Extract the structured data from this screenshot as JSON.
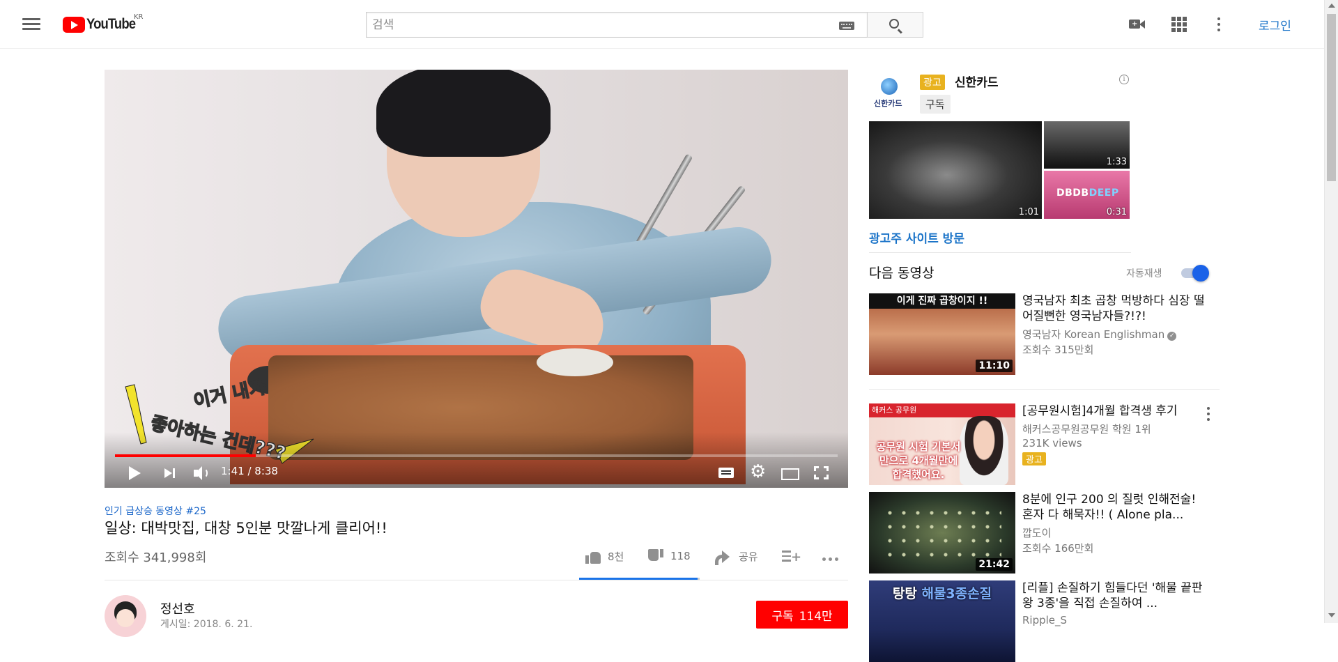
{
  "header": {
    "logo_text": "YouTube",
    "country_code": "KR",
    "search_placeholder": "검색",
    "search_value": "",
    "login_label": "로그인"
  },
  "player": {
    "caption_line1": "이거 내가",
    "caption_line2": "좋아하는 건데???",
    "time_current": "1:41",
    "time_separator": " / ",
    "time_total": "8:38",
    "progress_fraction": 0.195,
    "volume": "on"
  },
  "video": {
    "trending_label": "인기 급상승 동영상 #25",
    "title": "일상: 대박맛집, 대창 5인분 맛깔나게 클리어!!",
    "views": "조회수 341,998회",
    "likes": "8천",
    "dislikes": "118",
    "share_label": "공유",
    "like_ratio": 0.985
  },
  "channel": {
    "name": "정선호",
    "publish_date": "게시일: 2018. 6. 21.",
    "subscribe_label": "구독",
    "subscriber_count": "114만"
  },
  "ad": {
    "logo_text": "신한카드",
    "badge": "광고",
    "name": "신한카드",
    "subscribe_label": "구독",
    "thumb_durations": [
      "1:01",
      "1:33",
      "0:31"
    ],
    "thumb3_text_a": "DBDB",
    "thumb3_text_b": "DEEP",
    "visit_label": "광고주 사이트 방문"
  },
  "sidebar": {
    "up_next_label": "다음 동영상",
    "autoplay_label": "자동재생",
    "autoplay_on": true,
    "recommendations": [
      {
        "thumb_text": "이게 진짜 곱창이지 !!",
        "title": "영국남자 최초 곱창 먹방하다 심장 떨어질뻔한 영국남자들?!?!",
        "channel": "영국남자 Korean Englishman",
        "views": "조회수 315만회",
        "duration": "11:10"
      },
      {
        "thumb_tag": "해커스 공무원",
        "thumb_text": "공무원 시험 기본서만으로 4개월만에 합격했어요.",
        "title": "[공무원시험]4개월 합격생 후기",
        "channel": "해커스공무원공무원 학원 1위",
        "views": "231K views",
        "badge": "광고"
      },
      {
        "title": "8분에 인구 200 의 질럿 인해전술! 혼자 다 해묵자!! ( Alone pla...",
        "channel": "깝도이",
        "views": "조회수 166만회",
        "duration": "21:42"
      },
      {
        "thumb_text_a": "탕탕 ",
        "thumb_text_b": "해물3종손질",
        "title": "[리플] 손질하기 힘들다던 '해물 끝판왕 3종'을 직접 손질하여 ...",
        "channel": "Ripple_S"
      }
    ]
  },
  "colors": {
    "brand_red": "#ff0000",
    "link_blue": "#1a73c8",
    "ad_yellow": "#e8b21f",
    "toggle_blue": "#1a62e8"
  }
}
